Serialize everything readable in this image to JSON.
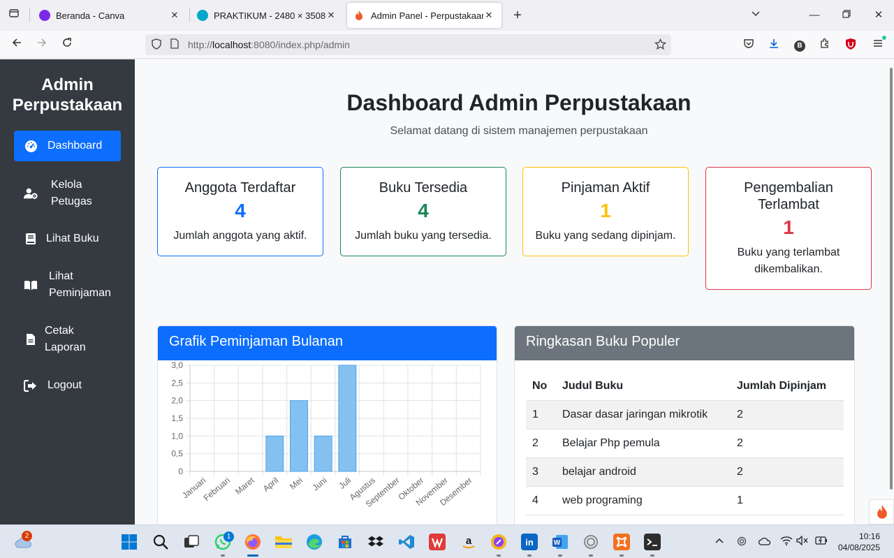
{
  "browser": {
    "tabs": [
      {
        "title": "Beranda - Canva",
        "active": false
      },
      {
        "title": "PRAKTIKUM - 2480 × 3508 piks",
        "active": false
      },
      {
        "title": "Admin Panel - Perpustakaan",
        "active": true
      }
    ],
    "url_prefix": "http://",
    "url_host": "localhost",
    "url_rest": ":8080/index.php/admin",
    "profile_letter": "B"
  },
  "sidebar": {
    "brand": "Admin Perpustakaan",
    "items": [
      {
        "label": "Dashboard",
        "icon": "gauge-icon",
        "active": true
      },
      {
        "label": "Kelola\nPetugas",
        "icon": "users-cog-icon",
        "active": false
      },
      {
        "label": "Lihat Buku",
        "icon": "book-icon",
        "active": false
      },
      {
        "label": "Lihat\nPeminjaman",
        "icon": "book-open-icon",
        "active": false
      },
      {
        "label": "Cetak\nLaporan",
        "icon": "file-icon",
        "active": false
      },
      {
        "label": "Logout",
        "icon": "logout-icon",
        "active": false
      }
    ]
  },
  "header": {
    "title": "Dashboard Admin Perpustakaan",
    "subtitle": "Selamat datang di sistem manajemen perpustakaan"
  },
  "cards": [
    {
      "title": "Anggota Terdaftar",
      "value": "4",
      "desc": "Jumlah anggota yang aktif.",
      "color": "#0d6efd"
    },
    {
      "title": "Buku Tersedia",
      "value": "4",
      "desc": "Jumlah buku yang tersedia.",
      "color": "#198754"
    },
    {
      "title": "Pinjaman Aktif",
      "value": "1",
      "desc": "Buku yang sedang dipinjam.",
      "color": "#ffc107"
    },
    {
      "title": "Pengembalian Terlambat",
      "value": "1",
      "desc": "Buku yang terlambat dikembalikan.",
      "color": "#dc3545"
    }
  ],
  "chart_panel": {
    "title": "Grafik Peminjaman Bulanan",
    "header_color": "#0d6efd"
  },
  "chart_data": {
    "type": "bar",
    "categories": [
      "Januari",
      "Februari",
      "Maret",
      "April",
      "Mei",
      "Juni",
      "Juli",
      "Agustus",
      "September",
      "Oktober",
      "November",
      "Desember"
    ],
    "values": [
      0,
      0,
      0,
      1,
      2,
      1,
      3,
      0,
      0,
      0,
      0,
      0
    ],
    "ylim": [
      0,
      3
    ],
    "yticks": [
      "0",
      "0,5",
      "1,0",
      "1,5",
      "2,0",
      "2,5",
      "3,0"
    ],
    "grid": true,
    "bar_color": "#85c1f0"
  },
  "popular_panel": {
    "title": "Ringkasan Buku Populer",
    "header_color": "#6c757d",
    "columns": [
      "No",
      "Judul Buku",
      "Jumlah Dipinjam"
    ],
    "rows": [
      [
        "1",
        "Dasar dasar jaringan mikrotik",
        "2"
      ],
      [
        "2",
        "Belajar Php pemula",
        "2"
      ],
      [
        "3",
        "belajar android",
        "2"
      ],
      [
        "4",
        "web programing",
        "1"
      ]
    ]
  },
  "taskbar": {
    "weather_badge": "2",
    "whatsapp_badge": "1",
    "time": "10:16",
    "date": "04/08/2025"
  }
}
